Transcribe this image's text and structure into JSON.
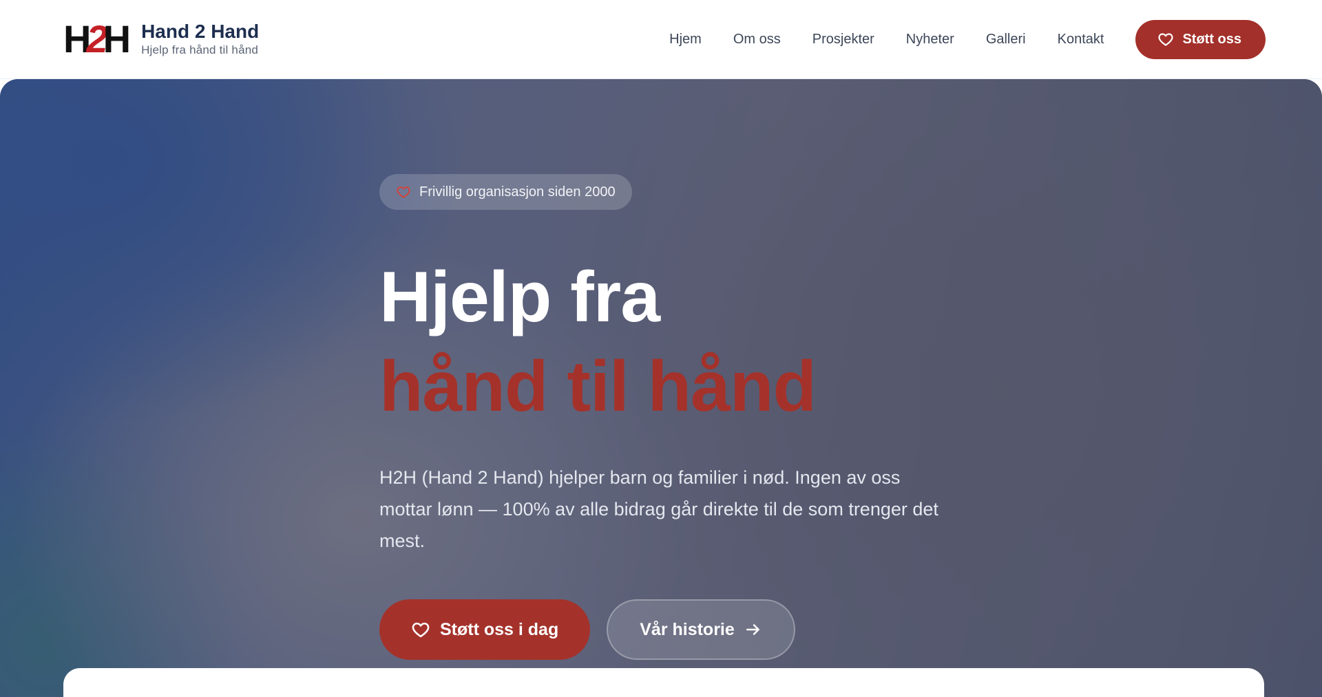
{
  "header": {
    "logo": {
      "h1": "H",
      "two": "2",
      "h2": "H"
    },
    "brand_name": "Hand 2 Hand",
    "tagline": "Hjelp fra hånd til hånd",
    "nav": [
      {
        "label": "Hjem"
      },
      {
        "label": "Om oss"
      },
      {
        "label": "Prosjekter"
      },
      {
        "label": "Nyheter"
      },
      {
        "label": "Galleri"
      },
      {
        "label": "Kontakt"
      }
    ],
    "cta": {
      "label": "Støtt oss",
      "icon": "heart-icon"
    }
  },
  "hero": {
    "badge": {
      "label": "Frivillig organisasjon siden 2000",
      "icon": "heart-icon"
    },
    "headline_line1": "Hjelp fra",
    "headline_line2": "hånd til hånd",
    "lead": "H2H (Hand 2 Hand) hjelper barn og familier i nød. Ingen av oss mottar lønn — 100% av alle bidrag går direkte til de som trenger det mest.",
    "primary_button": {
      "label": "Støtt oss i dag",
      "icon": "heart-icon"
    },
    "secondary_button": {
      "label": "Vår historie",
      "icon": "arrow-right-icon"
    }
  },
  "colors": {
    "accent": "#a4322b",
    "brand_navy": "#1d2e4f",
    "logo_red": "#c42026"
  }
}
